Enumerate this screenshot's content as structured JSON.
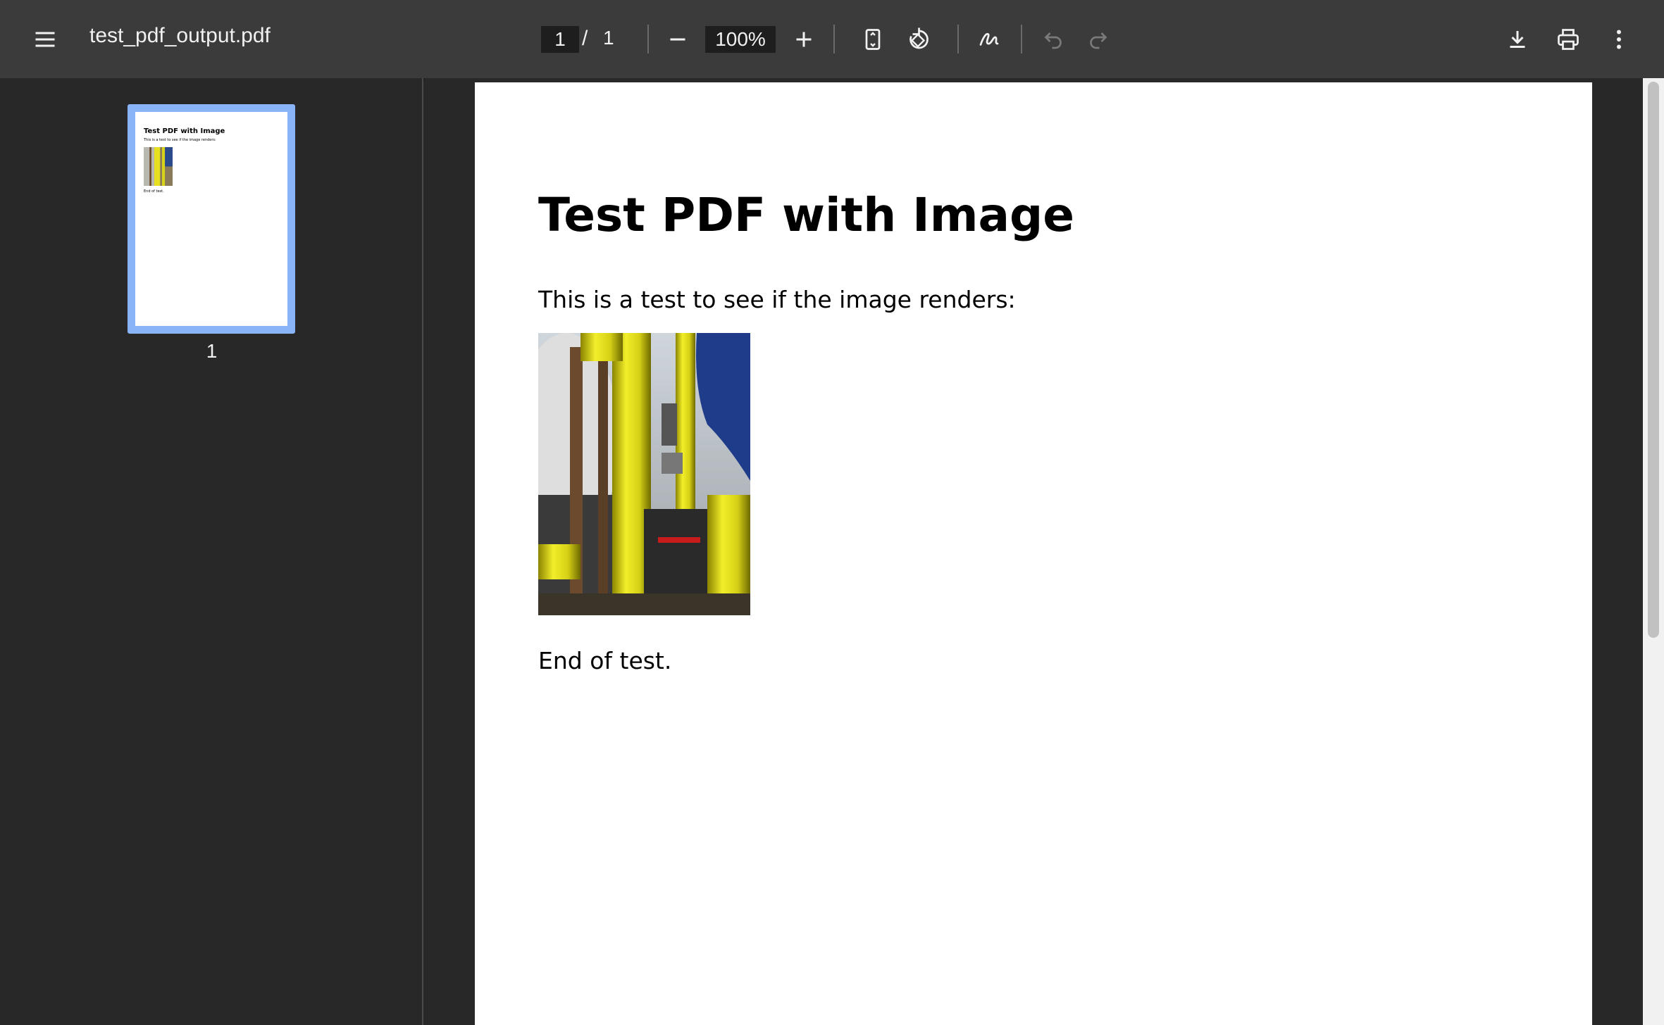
{
  "toolbar": {
    "title": "test_pdf_output.pdf",
    "current_page": "1",
    "page_separator": "/",
    "total_pages": "1",
    "zoom": "100%",
    "icons": {
      "menu": "menu-icon",
      "zoom_out": "minus-icon",
      "zoom_in": "plus-icon",
      "fit": "fit-page-icon",
      "rotate": "rotate-icon",
      "draw": "draw-icon",
      "undo": "undo-icon",
      "redo": "redo-icon",
      "download": "download-icon",
      "print": "print-icon",
      "more": "more-vert-icon"
    }
  },
  "sidebar": {
    "thumbnails": [
      {
        "page_number": "1",
        "title": "Test PDF with Image",
        "line": "This is a test to see if the image renders:",
        "end": "End of test."
      }
    ]
  },
  "document": {
    "title": "Test PDF with Image",
    "paragraph": "This is a test to see if the image renders:",
    "image": "yellow-pipes-photo",
    "closing": "End of test."
  },
  "colors": {
    "toolbar_bg": "#3b3b3b",
    "viewer_bg": "#282828",
    "thumb_selected": "#8ab4f8",
    "page_bg": "#ffffff",
    "text_light": "#f1f1f1"
  }
}
